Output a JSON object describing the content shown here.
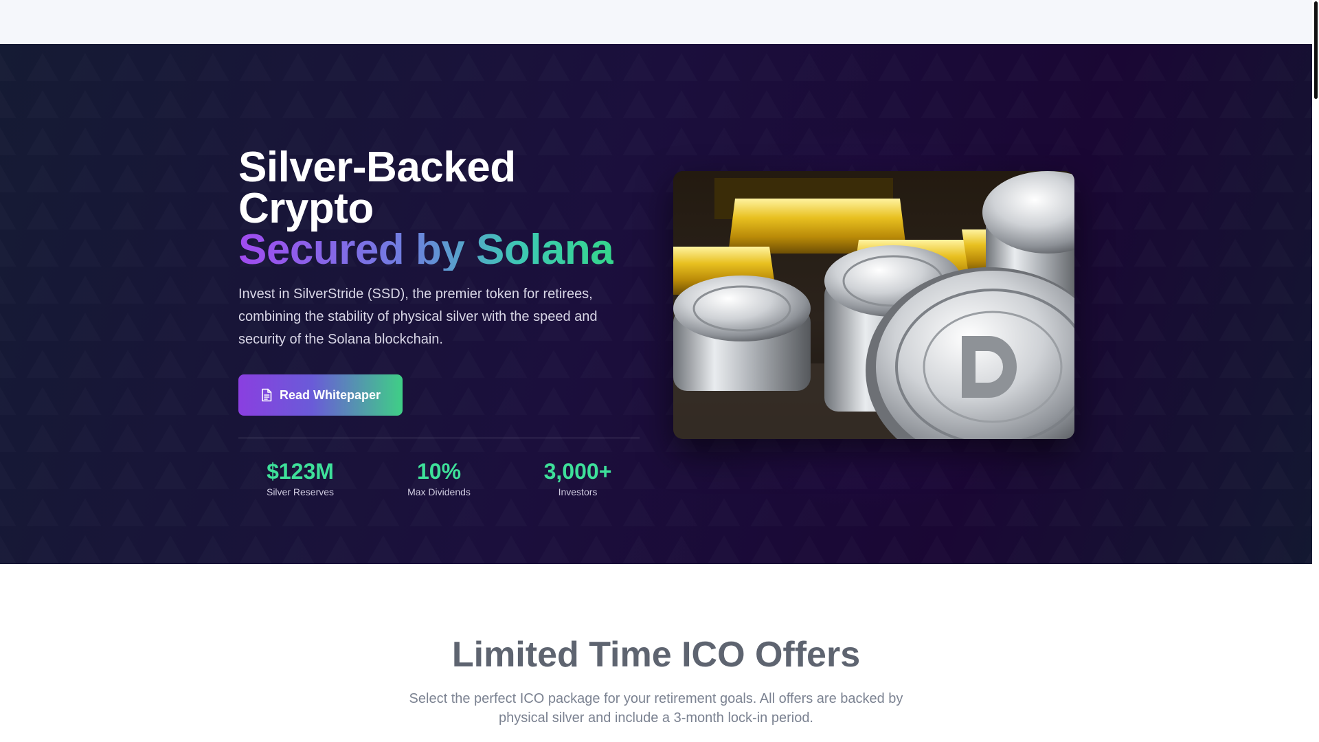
{
  "hero": {
    "title_line1": "Silver-Backed",
    "title_line2": "Crypto",
    "title_highlight": "Secured by Solana",
    "description": "Invest in SilverStride (SSD), the premier token for retirees, combining the stability of physical silver with the speed and security of the Solana blockchain.",
    "cta_label": "Read Whitepaper",
    "cta_icon": "document-icon",
    "image_icon": "silver-coins-image",
    "stats": [
      {
        "value": "$123M",
        "label": "Silver Reserves"
      },
      {
        "value": "10%",
        "label": "Max Dividends"
      },
      {
        "value": "3,000+",
        "label": "Investors"
      }
    ]
  },
  "offers": {
    "title": "Limited Time ICO Offers",
    "subtitle": "Select the perfect ICO package for your retirement goals. All offers are backed by physical silver and include a 3-month lock-in period."
  },
  "colors": {
    "accent_purple": "#8a3fe0",
    "accent_green": "#3ee09a",
    "hero_bg": "#1b0f3c"
  }
}
